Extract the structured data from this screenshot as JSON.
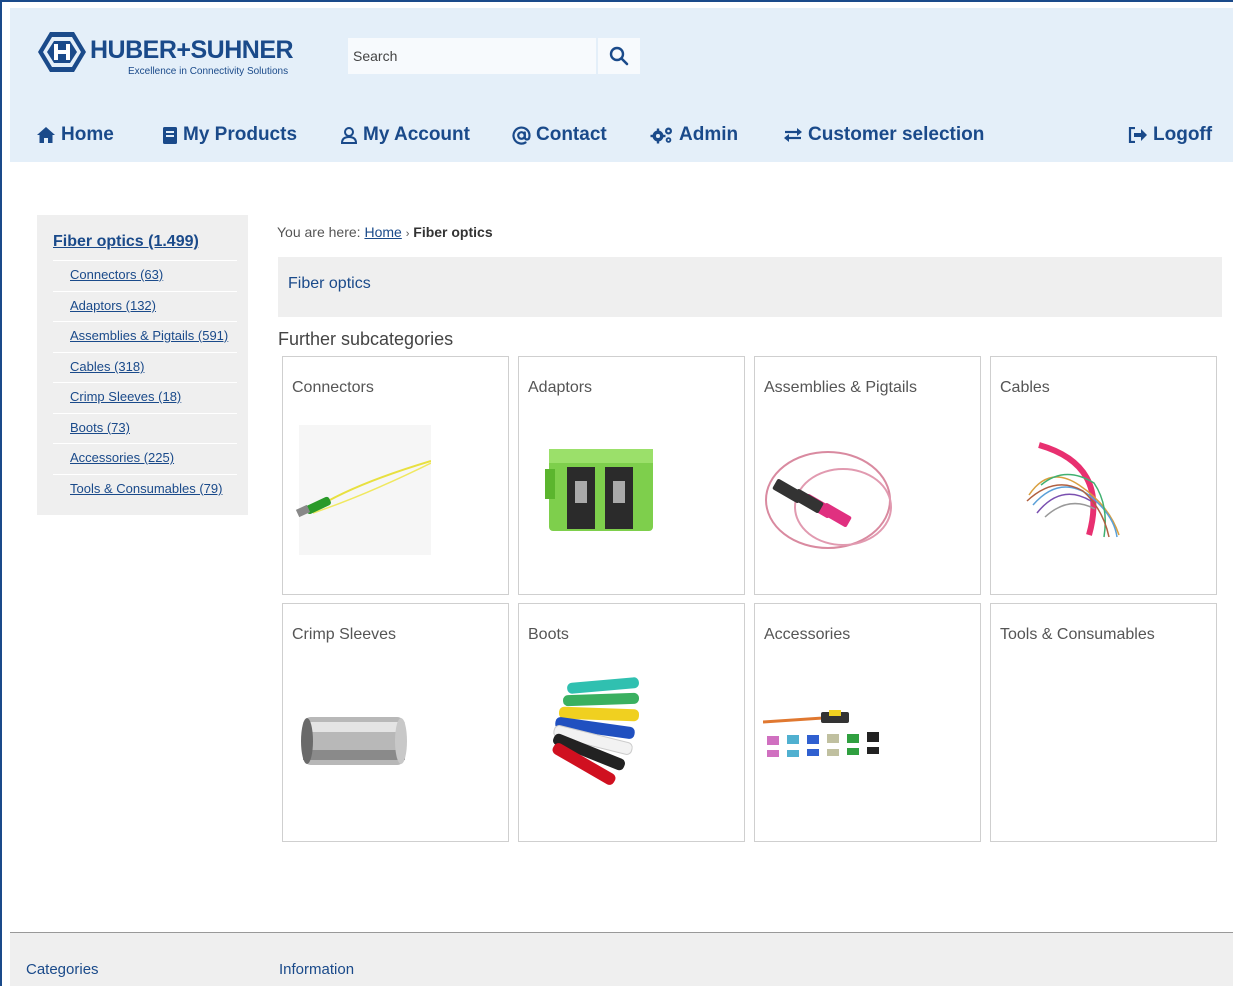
{
  "brand": {
    "name": "HUBER+SUHNER",
    "tagline": "Excellence in Connectivity Solutions",
    "color": "#1a4a8a"
  },
  "search": {
    "placeholder": "Search",
    "value": ""
  },
  "nav": {
    "home": "Home",
    "products": "My Products",
    "account": "My Account",
    "contact": "Contact",
    "admin": "Admin",
    "customer": "Customer selection",
    "logoff": "Logoff"
  },
  "sidebar": {
    "heading": "Fiber optics (1.499)",
    "items": [
      "Connectors (63)",
      "Adaptors (132)",
      "Assemblies & Pigtails (591)",
      "Cables (318)",
      "Crimp Sleeves (18)",
      "Boots (73)",
      "Accessories (225)",
      "Tools & Consumables (79)"
    ]
  },
  "breadcrumb": {
    "prefix": "You are here:",
    "home": "Home",
    "separator": "›",
    "current": "Fiber optics"
  },
  "category": {
    "title": "Fiber optics"
  },
  "subcategories": {
    "title": "Further subcategories",
    "tiles": [
      "Connectors",
      "Adaptors",
      "Assemblies & Pigtails",
      "Cables",
      "Crimp Sleeves",
      "Boots",
      "Accessories",
      "Tools & Consumables"
    ]
  },
  "footer": {
    "categories": "Categories",
    "information": "Information"
  }
}
